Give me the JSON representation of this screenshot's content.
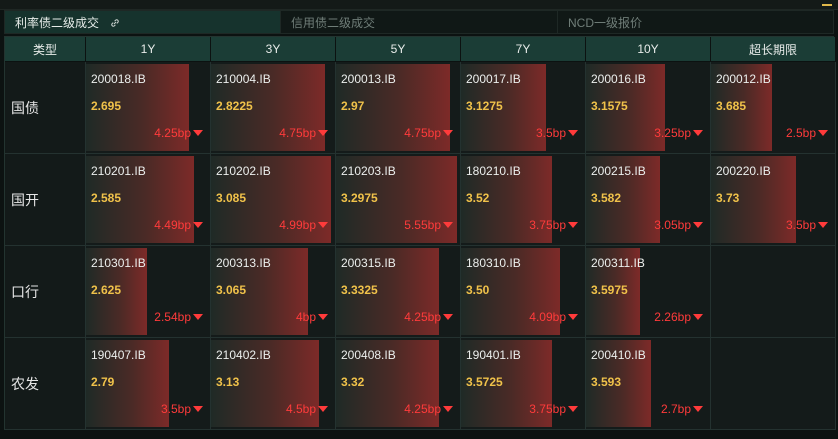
{
  "tabs": [
    {
      "label": "利率债二级成交",
      "active": true,
      "width": 276
    },
    {
      "label": "信用债二级成交",
      "active": false,
      "width": 277
    },
    {
      "label": "NCD一级报价",
      "active": false,
      "width": 277
    }
  ],
  "table": {
    "corner": "类型",
    "columns": [
      "1Y",
      "3Y",
      "5Y",
      "7Y",
      "10Y",
      "超长期限"
    ],
    "rows": [
      {
        "name": "国债",
        "cells": [
          {
            "code": "200018.IB",
            "yield": "2.695",
            "change": "4.25bp",
            "fill": 0.85
          },
          {
            "code": "210004.IB",
            "yield": "2.8225",
            "change": "4.75bp",
            "fill": 0.94
          },
          {
            "code": "200013.IB",
            "yield": "2.97",
            "change": "4.75bp",
            "fill": 0.94
          },
          {
            "code": "200017.IB",
            "yield": "3.1275",
            "change": "3.5bp",
            "fill": 0.7
          },
          {
            "code": "200016.IB",
            "yield": "3.1575",
            "change": "3.25bp",
            "fill": 0.65
          },
          {
            "code": "200012.IB",
            "yield": "3.685",
            "change": "2.5bp",
            "fill": 0.5
          }
        ]
      },
      {
        "name": "国开",
        "cells": [
          {
            "code": "210201.IB",
            "yield": "2.585",
            "change": "4.49bp",
            "fill": 0.89
          },
          {
            "code": "210202.IB",
            "yield": "3.085",
            "change": "4.99bp",
            "fill": 0.99
          },
          {
            "code": "210203.IB",
            "yield": "3.2975",
            "change": "5.55bp",
            "fill": 1.0
          },
          {
            "code": "180210.IB",
            "yield": "3.52",
            "change": "3.75bp",
            "fill": 0.75
          },
          {
            "code": "200215.IB",
            "yield": "3.582",
            "change": "3.05bp",
            "fill": 0.61
          },
          {
            "code": "200220.IB",
            "yield": "3.73",
            "change": "3.5bp",
            "fill": 0.7
          }
        ]
      },
      {
        "name": "口行",
        "cells": [
          {
            "code": "210301.IB",
            "yield": "2.625",
            "change": "2.54bp",
            "fill": 0.5
          },
          {
            "code": "200313.IB",
            "yield": "3.065",
            "change": "4bp",
            "fill": 0.8
          },
          {
            "code": "200315.IB",
            "yield": "3.3325",
            "change": "4.25bp",
            "fill": 0.85
          },
          {
            "code": "180310.IB",
            "yield": "3.50",
            "change": "4.09bp",
            "fill": 0.82
          },
          {
            "code": "200311.IB",
            "yield": "3.5975",
            "change": "2.26bp",
            "fill": 0.45
          },
          null
        ]
      },
      {
        "name": "农发",
        "cells": [
          {
            "code": "190407.IB",
            "yield": "2.79",
            "change": "3.5bp",
            "fill": 0.69
          },
          {
            "code": "210402.IB",
            "yield": "3.13",
            "change": "4.5bp",
            "fill": 0.89
          },
          {
            "code": "200408.IB",
            "yield": "3.32",
            "change": "4.25bp",
            "fill": 0.85
          },
          {
            "code": "190401.IB",
            "yield": "3.5725",
            "change": "3.75bp",
            "fill": 0.75
          },
          {
            "code": "200410.IB",
            "yield": "3.593",
            "change": "2.7bp",
            "fill": 0.54
          },
          null
        ]
      }
    ]
  },
  "colors": {
    "up": "#ff3b3b",
    "yield": "#f0c24a",
    "header": "#1b3d36",
    "activeTab": "#16332d"
  }
}
